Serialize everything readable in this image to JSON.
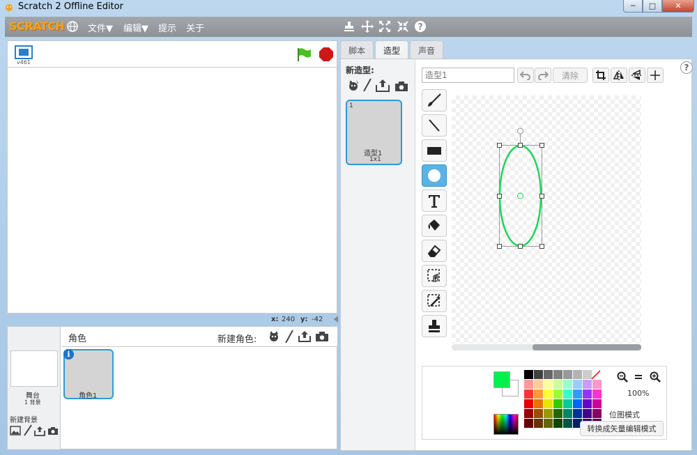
{
  "window": {
    "title": "Scratch 2 Offline Editor",
    "minimize": "─",
    "maximize": "□",
    "close": "✕"
  },
  "menubar": {
    "logo": "SCRATCH",
    "items": [
      "文件▼",
      "编辑▼",
      "提示",
      "关于"
    ]
  },
  "stage": {
    "version": "v461",
    "coord_x_label": "x:",
    "coord_x_value": "240",
    "coord_y_label": "y:",
    "coord_y_value": "-42"
  },
  "sprites_panel": {
    "stage_label": "舞台",
    "backdrop_count": "1 背景",
    "new_backdrop": "新建背景",
    "header": "角色",
    "new_sprite": "新建角色:",
    "sprite_name": "角色1",
    "info": "i"
  },
  "tabs": [
    "脚本",
    "造型",
    "声音"
  ],
  "costumes": {
    "new_label": "新造型:",
    "index": "1",
    "name": "造型1",
    "size": "1x1"
  },
  "editor": {
    "name_placeholder": "造型1",
    "clear": "清除",
    "zoom": "100%",
    "mode_label": "位图模式",
    "mode_button": "转换成矢量编辑模式",
    "help": "?"
  },
  "colors": {
    "accent": "#2e9ad6",
    "primary_color": "#00f24a",
    "ellipse_stroke": "#1ed45a"
  },
  "palette": [
    "#000000",
    "#404040",
    "#666666",
    "#808080",
    "#999999",
    "#b3b3b3",
    "#cccccc",
    "#ffffff",
    "#ff9999",
    "#ffcc99",
    "#ffff99",
    "#ccff99",
    "#99ffcc",
    "#99ccff",
    "#cc99ff",
    "#ff99cc",
    "#ff3333",
    "#ff9933",
    "#ffff33",
    "#99ff33",
    "#33ffcc",
    "#3399ff",
    "#9933ff",
    "#ff33cc",
    "#e60000",
    "#e67300",
    "#e6e600",
    "#33cc00",
    "#00cc99",
    "#0066ff",
    "#6600cc",
    "#cc0099",
    "#990000",
    "#994d00",
    "#999900",
    "#226600",
    "#008866",
    "#003399",
    "#440088",
    "#880066",
    "#660000",
    "#663300",
    "#666600",
    "#114400",
    "#005544",
    "#002266",
    "#330066",
    "#550044"
  ]
}
